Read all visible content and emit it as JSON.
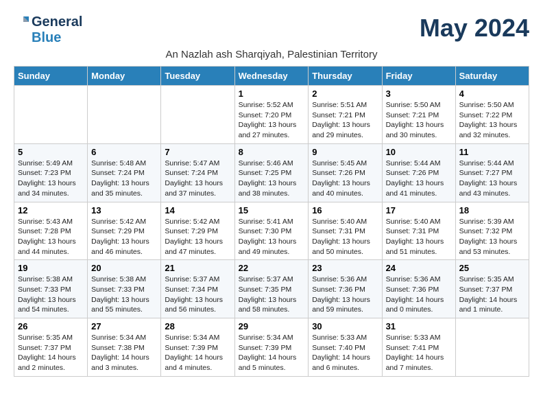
{
  "header": {
    "logo_line1": "General",
    "logo_line2": "Blue",
    "month_title": "May 2024",
    "subtitle": "An Nazlah ash Sharqiyah, Palestinian Territory"
  },
  "weekdays": [
    "Sunday",
    "Monday",
    "Tuesday",
    "Wednesday",
    "Thursday",
    "Friday",
    "Saturday"
  ],
  "weeks": [
    [
      {
        "day": "",
        "info": ""
      },
      {
        "day": "",
        "info": ""
      },
      {
        "day": "",
        "info": ""
      },
      {
        "day": "1",
        "info": "Sunrise: 5:52 AM\nSunset: 7:20 PM\nDaylight: 13 hours\nand 27 minutes."
      },
      {
        "day": "2",
        "info": "Sunrise: 5:51 AM\nSunset: 7:21 PM\nDaylight: 13 hours\nand 29 minutes."
      },
      {
        "day": "3",
        "info": "Sunrise: 5:50 AM\nSunset: 7:21 PM\nDaylight: 13 hours\nand 30 minutes."
      },
      {
        "day": "4",
        "info": "Sunrise: 5:50 AM\nSunset: 7:22 PM\nDaylight: 13 hours\nand 32 minutes."
      }
    ],
    [
      {
        "day": "5",
        "info": "Sunrise: 5:49 AM\nSunset: 7:23 PM\nDaylight: 13 hours\nand 34 minutes."
      },
      {
        "day": "6",
        "info": "Sunrise: 5:48 AM\nSunset: 7:24 PM\nDaylight: 13 hours\nand 35 minutes."
      },
      {
        "day": "7",
        "info": "Sunrise: 5:47 AM\nSunset: 7:24 PM\nDaylight: 13 hours\nand 37 minutes."
      },
      {
        "day": "8",
        "info": "Sunrise: 5:46 AM\nSunset: 7:25 PM\nDaylight: 13 hours\nand 38 minutes."
      },
      {
        "day": "9",
        "info": "Sunrise: 5:45 AM\nSunset: 7:26 PM\nDaylight: 13 hours\nand 40 minutes."
      },
      {
        "day": "10",
        "info": "Sunrise: 5:44 AM\nSunset: 7:26 PM\nDaylight: 13 hours\nand 41 minutes."
      },
      {
        "day": "11",
        "info": "Sunrise: 5:44 AM\nSunset: 7:27 PM\nDaylight: 13 hours\nand 43 minutes."
      }
    ],
    [
      {
        "day": "12",
        "info": "Sunrise: 5:43 AM\nSunset: 7:28 PM\nDaylight: 13 hours\nand 44 minutes."
      },
      {
        "day": "13",
        "info": "Sunrise: 5:42 AM\nSunset: 7:29 PM\nDaylight: 13 hours\nand 46 minutes."
      },
      {
        "day": "14",
        "info": "Sunrise: 5:42 AM\nSunset: 7:29 PM\nDaylight: 13 hours\nand 47 minutes."
      },
      {
        "day": "15",
        "info": "Sunrise: 5:41 AM\nSunset: 7:30 PM\nDaylight: 13 hours\nand 49 minutes."
      },
      {
        "day": "16",
        "info": "Sunrise: 5:40 AM\nSunset: 7:31 PM\nDaylight: 13 hours\nand 50 minutes."
      },
      {
        "day": "17",
        "info": "Sunrise: 5:40 AM\nSunset: 7:31 PM\nDaylight: 13 hours\nand 51 minutes."
      },
      {
        "day": "18",
        "info": "Sunrise: 5:39 AM\nSunset: 7:32 PM\nDaylight: 13 hours\nand 53 minutes."
      }
    ],
    [
      {
        "day": "19",
        "info": "Sunrise: 5:38 AM\nSunset: 7:33 PM\nDaylight: 13 hours\nand 54 minutes."
      },
      {
        "day": "20",
        "info": "Sunrise: 5:38 AM\nSunset: 7:33 PM\nDaylight: 13 hours\nand 55 minutes."
      },
      {
        "day": "21",
        "info": "Sunrise: 5:37 AM\nSunset: 7:34 PM\nDaylight: 13 hours\nand 56 minutes."
      },
      {
        "day": "22",
        "info": "Sunrise: 5:37 AM\nSunset: 7:35 PM\nDaylight: 13 hours\nand 58 minutes."
      },
      {
        "day": "23",
        "info": "Sunrise: 5:36 AM\nSunset: 7:36 PM\nDaylight: 13 hours\nand 59 minutes."
      },
      {
        "day": "24",
        "info": "Sunrise: 5:36 AM\nSunset: 7:36 PM\nDaylight: 14 hours\nand 0 minutes."
      },
      {
        "day": "25",
        "info": "Sunrise: 5:35 AM\nSunset: 7:37 PM\nDaylight: 14 hours\nand 1 minute."
      }
    ],
    [
      {
        "day": "26",
        "info": "Sunrise: 5:35 AM\nSunset: 7:37 PM\nDaylight: 14 hours\nand 2 minutes."
      },
      {
        "day": "27",
        "info": "Sunrise: 5:34 AM\nSunset: 7:38 PM\nDaylight: 14 hours\nand 3 minutes."
      },
      {
        "day": "28",
        "info": "Sunrise: 5:34 AM\nSunset: 7:39 PM\nDaylight: 14 hours\nand 4 minutes."
      },
      {
        "day": "29",
        "info": "Sunrise: 5:34 AM\nSunset: 7:39 PM\nDaylight: 14 hours\nand 5 minutes."
      },
      {
        "day": "30",
        "info": "Sunrise: 5:33 AM\nSunset: 7:40 PM\nDaylight: 14 hours\nand 6 minutes."
      },
      {
        "day": "31",
        "info": "Sunrise: 5:33 AM\nSunset: 7:41 PM\nDaylight: 14 hours\nand 7 minutes."
      },
      {
        "day": "",
        "info": ""
      }
    ]
  ]
}
